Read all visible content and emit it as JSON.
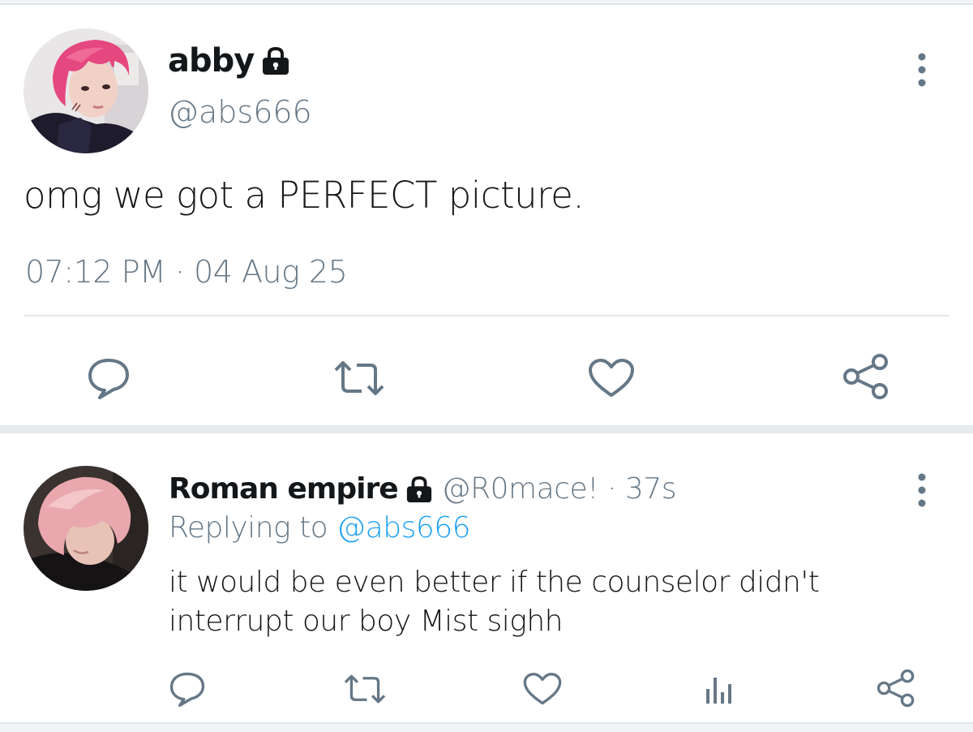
{
  "main_tweet": {
    "display_name": "abby",
    "handle": "@abs666",
    "text": "omg we got a PERFECT picture.",
    "timestamp": "07:12 PM · 04 Aug 25",
    "icons": {
      "lock": "lock-icon",
      "more": "more-vertical-icon",
      "reply": "reply-icon",
      "retweet": "retweet-icon",
      "like": "heart-icon",
      "share": "share-icon"
    }
  },
  "reply": {
    "display_name": "Roman empire",
    "handle_time": "@R0mace! · 37s",
    "replying_prefix": "Replying to",
    "replying_mention": "@abs666",
    "text": "it would be even better if the counselor didn't interrupt our boy Mist sighh",
    "icons": {
      "lock": "lock-icon",
      "more": "more-vertical-icon",
      "reply": "reply-icon",
      "retweet": "retweet-icon",
      "like": "heart-icon",
      "analytics": "analytics-icon",
      "share": "share-icon"
    }
  },
  "colors": {
    "text_primary": "#14171a",
    "text_secondary": "#657786",
    "link": "#1da1f2",
    "icon": "#657786",
    "divider": "#e1e8ed"
  }
}
